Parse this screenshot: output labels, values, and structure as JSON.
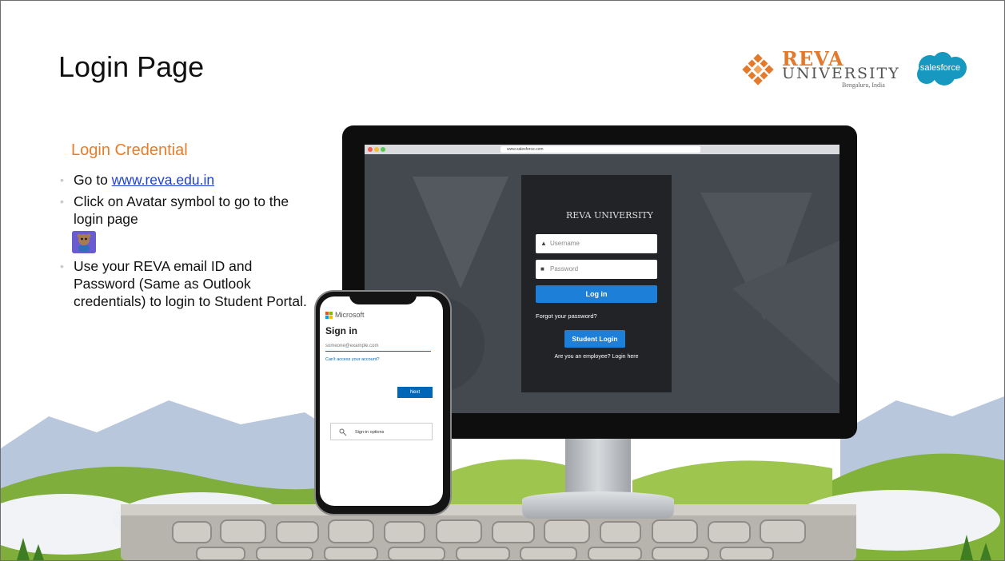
{
  "slide": {
    "title": "Login Page",
    "section_title": "Login Credential",
    "bullets": {
      "b1_prefix": "Go to ",
      "b1_link": "www.reva.edu.in",
      "b2": "Click on Avatar symbol to go to the login page",
      "b3": "Use your REVA email ID and Password (Same as Outlook credentials) to login to Student Portal."
    }
  },
  "logos": {
    "reva_word": "REVA",
    "reva_university": "UNIVERSITY",
    "reva_location": "Bengaluru, India",
    "salesforce": "salesforce"
  },
  "monitor_login": {
    "browser_url": "www.salesforce.com",
    "panel_logo": "REVA UNIVERSITY",
    "username_placeholder": "Username",
    "password_placeholder": "Password",
    "login_button": "Log in",
    "forgot_link": "Forgot your password?",
    "student_login_button": "Student Login",
    "employee_link": "Are you an employee? Login here"
  },
  "phone_login": {
    "brand": "Microsoft",
    "heading": "Sign in",
    "email_placeholder": "someone@example.com",
    "cant_access": "Can't access your account?",
    "next_button": "Next",
    "signin_options": "Sign-in options"
  },
  "colors": {
    "accent_orange": "#e77d2b",
    "link_blue": "#1a3fd6",
    "salesforce_blue": "#1798c1",
    "button_blue": "#1e7fd8",
    "ms_blue": "#0067b8"
  }
}
